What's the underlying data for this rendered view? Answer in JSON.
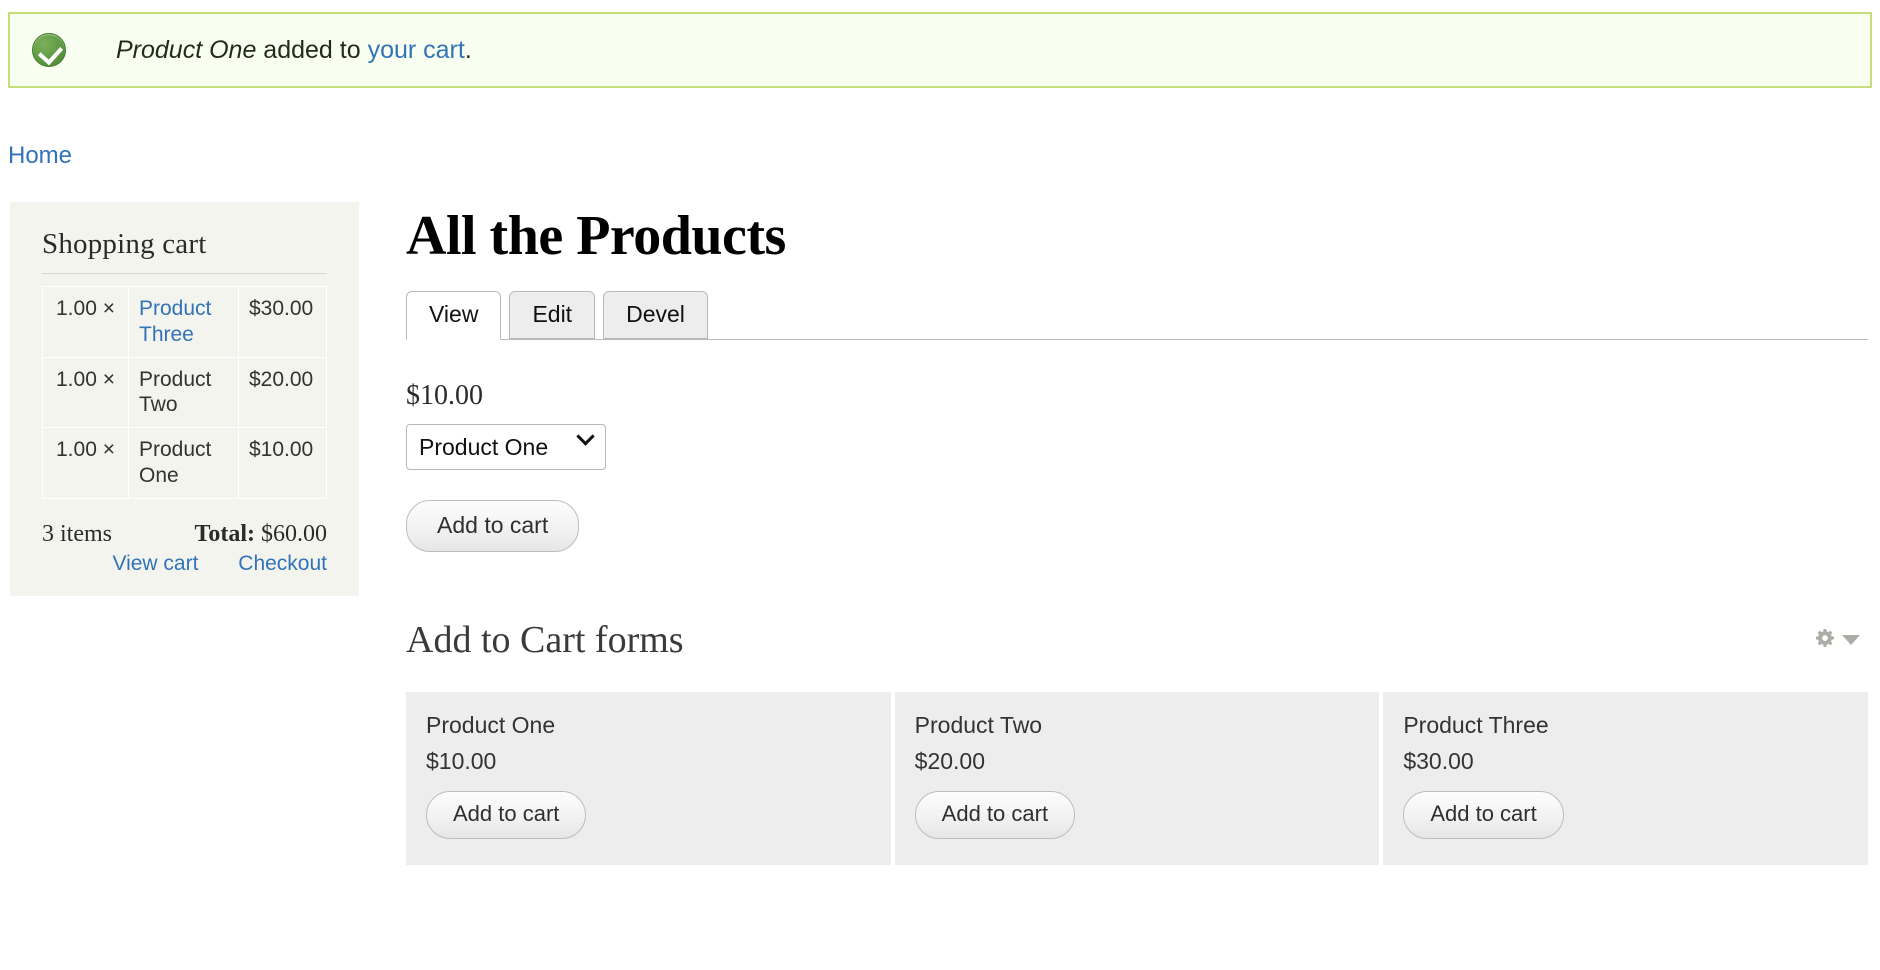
{
  "status_message": {
    "icon": "check-circle-icon",
    "product": "Product One",
    "middle": " added to ",
    "link": "your cart",
    "end": ".",
    "border_color": "#c5e07a",
    "background_color": "#f8fff0"
  },
  "breadcrumb": {
    "items": [
      "Home"
    ]
  },
  "cart_block": {
    "title": "Shopping cart",
    "rows": [
      {
        "quantity": "1.00 ×",
        "product": "Product Three",
        "is_link": true,
        "total": "$30.00"
      },
      {
        "quantity": "1.00 ×",
        "product": "Product Two",
        "is_link": false,
        "total": "$20.00"
      },
      {
        "quantity": "1.00 ×",
        "product": "Product One",
        "is_link": false,
        "total": "$10.00"
      }
    ],
    "items_count": "3 items",
    "total_label": "Total:",
    "total_value": "$60.00",
    "view_cart_label": "View cart",
    "checkout_label": "Checkout",
    "link_color": "#3273b8"
  },
  "main": {
    "page_title": "All the Products",
    "tabs": [
      {
        "label": "View",
        "active": true
      },
      {
        "label": "Edit",
        "active": false
      },
      {
        "label": "Devel",
        "active": false
      }
    ],
    "product_view": {
      "price": "$10.00",
      "variation_selected": "Product One",
      "variation_options": [
        "Product One",
        "Product Two",
        "Product Three"
      ],
      "add_to_cart_label": "Add to cart"
    },
    "forms_section": {
      "title": "Add to Cart forms",
      "contextual_icons": [
        "gear-icon",
        "caret-down-icon"
      ],
      "cards": [
        {
          "name": "Product One",
          "price": "$10.00",
          "button": "Add to cart"
        },
        {
          "name": "Product Two",
          "price": "$20.00",
          "button": "Add to cart"
        },
        {
          "name": "Product Three",
          "price": "$30.00",
          "button": "Add to cart"
        }
      ]
    }
  }
}
